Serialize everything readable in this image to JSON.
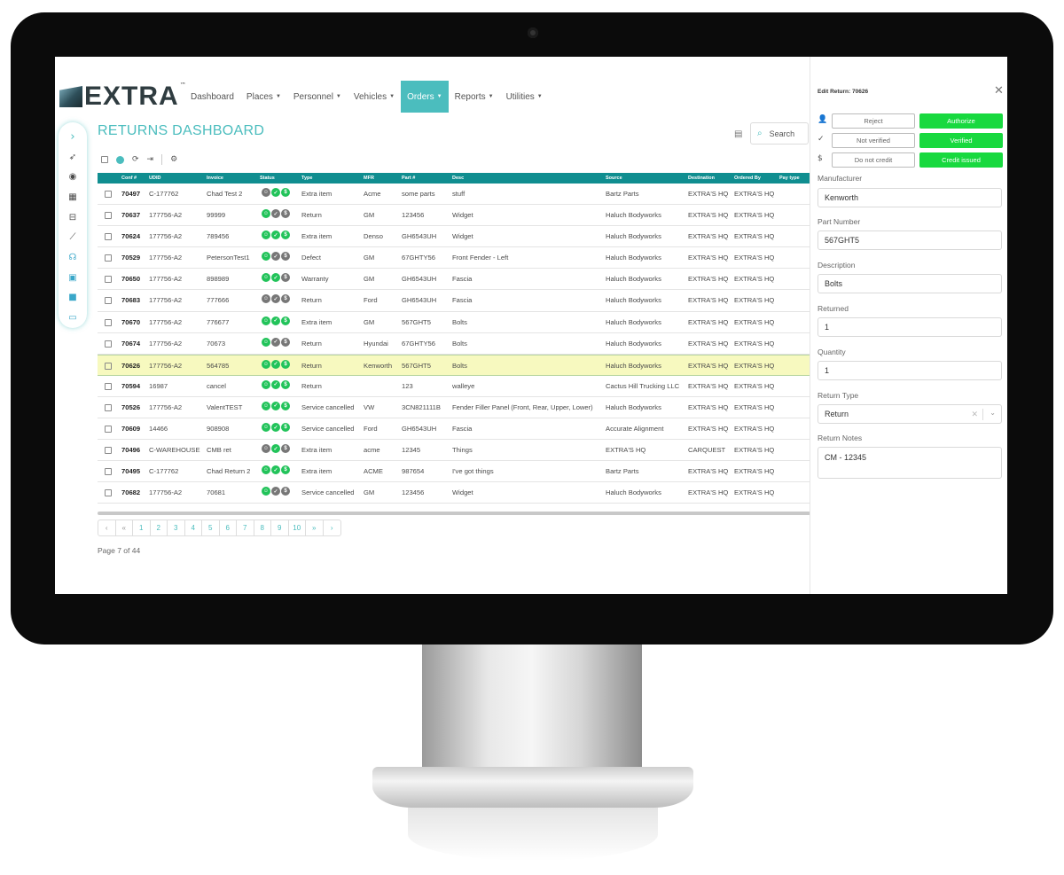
{
  "nav": {
    "logo_text": "EXTRA",
    "logo_tm": "™",
    "menu": [
      {
        "label": "Dashboard",
        "caret": ""
      },
      {
        "label": "Places",
        "caret": "▼"
      },
      {
        "label": "Personnel",
        "caret": "▼"
      },
      {
        "label": "Vehicles",
        "caret": "▼"
      },
      {
        "label": "Orders",
        "caret": "▼",
        "active": true
      },
      {
        "label": "Reports",
        "caret": "▼"
      },
      {
        "label": "Utilities",
        "caret": "▼"
      }
    ]
  },
  "rail": {
    "icons": [
      "chevron-right-icon",
      "rocket-icon",
      "eye-icon",
      "calendar-icon",
      "inbox-icon",
      "chart-line-icon",
      "headset-icon",
      "bus-icon",
      "video-icon",
      "image-icon"
    ]
  },
  "page": {
    "title": "RETURNS DASHBOARD",
    "search_label": "Search"
  },
  "table": {
    "headers": [
      "Conf #",
      "UDID",
      "Invoice",
      "Status",
      "Type",
      "MFR",
      "Part #",
      "Desc",
      "Source",
      "Destination",
      "Ordered By",
      "Pay type"
    ],
    "rows": [
      {
        "conf": "70497",
        "udid": "C-177762",
        "invoice": "Chad Test 2",
        "status": [
          "k",
          "g",
          "g"
        ],
        "type": "Extra item",
        "mfr": "Acme",
        "part": "some parts",
        "desc": "stuff",
        "source": "Bartz Parts",
        "dest": "EXTRA'S HQ",
        "ordered": "EXTRA'S HQ",
        "pay": ""
      },
      {
        "conf": "70637",
        "udid": "177756-A2",
        "invoice": "99999",
        "status": [
          "g",
          "k",
          "k"
        ],
        "type": "Return",
        "mfr": "GM",
        "part": "123456",
        "desc": "Widget",
        "source": "Haluch Bodyworks",
        "dest": "EXTRA'S HQ",
        "ordered": "EXTRA'S HQ",
        "pay": ""
      },
      {
        "conf": "70624",
        "udid": "177756-A2",
        "invoice": "789456",
        "status": [
          "g",
          "g",
          "g"
        ],
        "type": "Extra item",
        "mfr": "Denso",
        "part": "GH6543UH",
        "desc": "Widget",
        "source": "Haluch Bodyworks",
        "dest": "EXTRA'S HQ",
        "ordered": "EXTRA'S HQ",
        "pay": ""
      },
      {
        "conf": "70529",
        "udid": "177756-A2",
        "invoice": "PetersonTest1",
        "status": [
          "g",
          "k",
          "k"
        ],
        "type": "Defect",
        "mfr": "GM",
        "part": "67GHTY56",
        "desc": "Front Fender - Left",
        "source": "Haluch Bodyworks",
        "dest": "EXTRA'S HQ",
        "ordered": "EXTRA'S HQ",
        "pay": ""
      },
      {
        "conf": "70650",
        "udid": "177756-A2",
        "invoice": "898989",
        "status": [
          "g",
          "g",
          "k"
        ],
        "type": "Warranty",
        "mfr": "GM",
        "part": "GH6543UH",
        "desc": "Fascia",
        "source": "Haluch Bodyworks",
        "dest": "EXTRA'S HQ",
        "ordered": "EXTRA'S HQ",
        "pay": ""
      },
      {
        "conf": "70683",
        "udid": "177756-A2",
        "invoice": "777666",
        "status": [
          "k",
          "k",
          "k"
        ],
        "type": "Return",
        "mfr": "Ford",
        "part": "GH6543UH",
        "desc": "Fascia",
        "source": "Haluch Bodyworks",
        "dest": "EXTRA'S HQ",
        "ordered": "EXTRA'S HQ",
        "pay": ""
      },
      {
        "conf": "70670",
        "udid": "177756-A2",
        "invoice": "776677",
        "status": [
          "g",
          "g",
          "g"
        ],
        "type": "Extra item",
        "mfr": "GM",
        "part": "567GHT5",
        "desc": "Bolts",
        "source": "Haluch Bodyworks",
        "dest": "EXTRA'S HQ",
        "ordered": "EXTRA'S HQ",
        "pay": ""
      },
      {
        "conf": "70674",
        "udid": "177756-A2",
        "invoice": "70673",
        "status": [
          "g",
          "k",
          "k"
        ],
        "type": "Return",
        "mfr": "Hyundai",
        "part": "67GHTY56",
        "desc": "Bolts",
        "source": "Haluch Bodyworks",
        "dest": "EXTRA'S HQ",
        "ordered": "EXTRA'S HQ",
        "pay": ""
      },
      {
        "conf": "70626",
        "udid": "177756-A2",
        "invoice": "564785",
        "status": [
          "g",
          "g",
          "g"
        ],
        "type": "Return",
        "mfr": "Kenworth",
        "part": "567GHT5",
        "desc": "Bolts",
        "source": "Haluch Bodyworks",
        "dest": "EXTRA'S HQ",
        "ordered": "EXTRA'S HQ",
        "pay": "",
        "selected": true
      },
      {
        "conf": "70594",
        "udid": "16987",
        "invoice": "cancel",
        "status": [
          "g",
          "g",
          "g"
        ],
        "type": "Return",
        "mfr": "",
        "part": "123",
        "desc": "walleye",
        "source": "Cactus Hill Trucking LLC",
        "dest": "EXTRA'S HQ",
        "ordered": "EXTRA'S HQ",
        "pay": ""
      },
      {
        "conf": "70526",
        "udid": "177756-A2",
        "invoice": "ValentTEST",
        "status": [
          "g",
          "g",
          "g"
        ],
        "type": "Service cancelled",
        "mfr": "VW",
        "part": "3CN821111B",
        "desc": "Fender Filler Panel (Front, Rear, Upper, Lower)",
        "source": "Haluch Bodyworks",
        "dest": "EXTRA'S HQ",
        "ordered": "EXTRA'S HQ",
        "pay": ""
      },
      {
        "conf": "70609",
        "udid": "14466",
        "invoice": "908908",
        "status": [
          "g",
          "g",
          "g"
        ],
        "type": "Service cancelled",
        "mfr": "Ford",
        "part": "GH6543UH",
        "desc": "Fascia",
        "source": "Accurate Alignment",
        "dest": "EXTRA'S HQ",
        "ordered": "EXTRA'S HQ",
        "pay": ""
      },
      {
        "conf": "70496",
        "udid": "C-WAREHOUSE",
        "invoice": "CMB ret",
        "status": [
          "k",
          "g",
          "k"
        ],
        "type": "Extra item",
        "mfr": "acme",
        "part": "12345",
        "desc": "Things",
        "source": "EXTRA'S HQ",
        "dest": "CARQUEST",
        "ordered": "EXTRA'S HQ",
        "pay": ""
      },
      {
        "conf": "70495",
        "udid": "C-177762",
        "invoice": "Chad Return 2",
        "status": [
          "g",
          "g",
          "g"
        ],
        "type": "Extra item",
        "mfr": "ACME",
        "part": "987654",
        "desc": "I've got things",
        "source": "Bartz Parts",
        "dest": "EXTRA'S HQ",
        "ordered": "EXTRA'S HQ",
        "pay": ""
      },
      {
        "conf": "70682",
        "udid": "177756-A2",
        "invoice": "70681",
        "status": [
          "g",
          "k",
          "k"
        ],
        "type": "Service cancelled",
        "mfr": "GM",
        "part": "123456",
        "desc": "Widget",
        "source": "Haluch Bodyworks",
        "dest": "EXTRA'S HQ",
        "ordered": "EXTRA'S HQ",
        "pay": ""
      }
    ]
  },
  "pager": {
    "items": [
      "‹",
      "«",
      "1",
      "2",
      "3",
      "4",
      "5",
      "6",
      "7",
      "8",
      "9",
      "10",
      "»",
      "›"
    ],
    "info": "Page 7 of 44"
  },
  "panel": {
    "title": "Edit Return: 70626",
    "actions": [
      {
        "icon": "user-check-icon",
        "glyph": "👤",
        "out": "Reject",
        "ok": "Authorize"
      },
      {
        "icon": "check-icon",
        "glyph": "✓",
        "out": "Not verified",
        "ok": "Verified"
      },
      {
        "icon": "dollar-icon",
        "glyph": "$",
        "out": "Do not credit",
        "ok": "Credit issued"
      }
    ],
    "manufacturer_label": "Manufacturer",
    "manufacturer_value": "Kenworth",
    "part_label": "Part Number",
    "part_value": "567GHT5",
    "desc_label": "Description",
    "desc_value": "Bolts",
    "returned_label": "Returned",
    "returned_value": "1",
    "quantity_label": "Quantity",
    "quantity_value": "1",
    "type_label": "Return Type",
    "type_value": "Return",
    "notes_label": "Return Notes",
    "notes_value": "CM - 12345"
  },
  "colors": {
    "accent": "#4bbdbe",
    "table_header": "#108e90",
    "success": "#18d93f",
    "selected_row": "#f7f9bf"
  }
}
